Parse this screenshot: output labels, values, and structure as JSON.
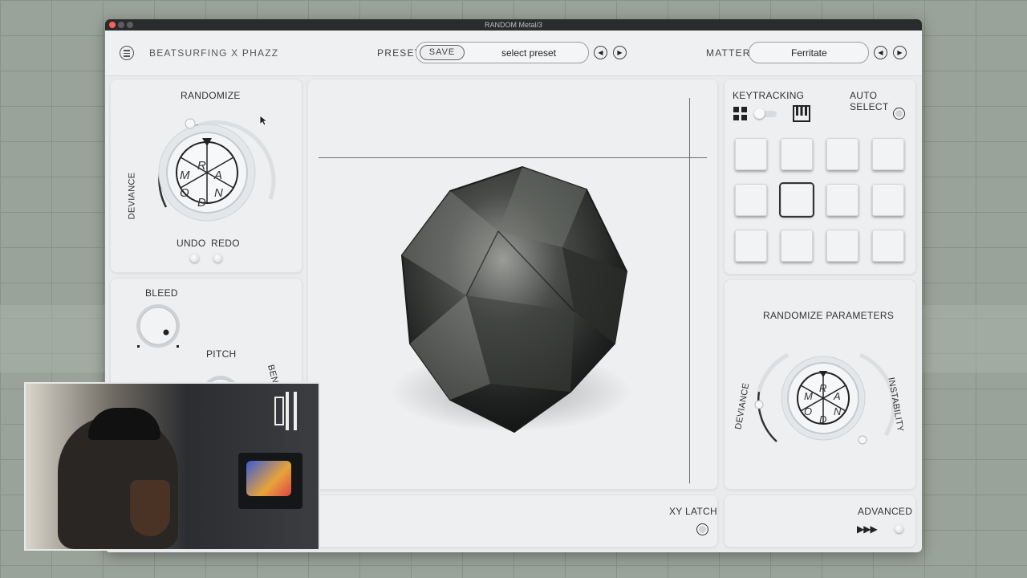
{
  "window": {
    "title": "RANDOM Metal/3"
  },
  "header": {
    "brand": "BEATSURFING X PHAZZ",
    "preset_label": "PRESET",
    "save_label": "SAVE",
    "preset_value": "select preset",
    "matter_label": "MATTER",
    "matter_value": "Ferritate",
    "prev_symbol": "◀",
    "next_symbol": "▶"
  },
  "randomize": {
    "label": "RANDOMIZE",
    "deviance_label": "DEVIANCE",
    "undo_label": "UNDO",
    "redo_label": "REDO",
    "wheel_letters": [
      "R",
      "A",
      "N",
      "D",
      "O",
      "M"
    ]
  },
  "bleed": {
    "label": "BLEED"
  },
  "pitch": {
    "label": "PITCH",
    "bend_label": "BEND"
  },
  "keytracking": {
    "label": "KEYTRACKING",
    "auto_select_label": "AUTO SELECT"
  },
  "pads": {
    "count": 12,
    "selected_index": 5
  },
  "randomize_params": {
    "label": "RANDOMIZE PARAMETERS",
    "deviance_label": "DEVIANCE",
    "instability_label": "INSTABILITY"
  },
  "footer": {
    "xy_latch_label": "XY LATCH",
    "advanced_label": "ADVANCED",
    "advanced_arrows": "▶▶▶"
  },
  "icons": [
    "menu-icon",
    "grid-icon",
    "piano-icon",
    "cursor-icon",
    "webcam-logo-icon"
  ],
  "colors": {
    "panel": "#edeff0",
    "window": "#e9ebec",
    "titlebar": "#2a2b2d",
    "rock": "#2b2e2c"
  }
}
